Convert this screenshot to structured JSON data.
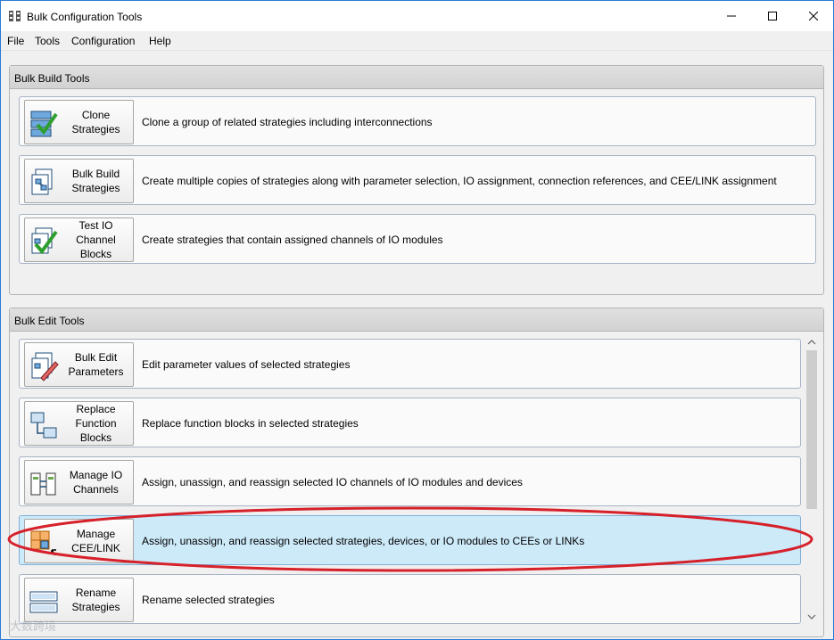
{
  "window": {
    "title": "Bulk Configuration Tools",
    "controls": [
      "minimize",
      "maximize",
      "close"
    ]
  },
  "menu": [
    "File",
    "Tools",
    "Configuration",
    "Help"
  ],
  "build_group": {
    "title": "Bulk Build Tools",
    "items": [
      {
        "label": "Clone\nStrategies",
        "desc": "Clone a group of related strategies including interconnections",
        "icon": "clone-strategies-icon"
      },
      {
        "label": "Bulk Build\nStrategies",
        "desc": "Create multiple copies of strategies along with parameter selection, IO assignment, connection references, and CEE/LINK assignment",
        "icon": "bulk-build-icon"
      },
      {
        "label": "Test IO\nChannel\nBlocks",
        "desc": "Create strategies that contain assigned channels of IO modules",
        "icon": "test-io-icon"
      }
    ]
  },
  "edit_group": {
    "title": "Bulk Edit Tools",
    "items": [
      {
        "label": "Bulk Edit\nParameters",
        "desc": "Edit parameter values of selected strategies",
        "icon": "bulk-edit-icon"
      },
      {
        "label": "Replace\nFunction\nBlocks",
        "desc": "Replace function blocks in selected strategies",
        "icon": "replace-blocks-icon"
      },
      {
        "label": "Manage IO\nChannels",
        "desc": "Assign, unassign, and reassign selected  IO channels of IO modules and devices",
        "icon": "manage-io-icon"
      },
      {
        "label": "Manage\nCEE/LINK",
        "desc": "Assign, unassign, and reassign selected strategies, devices, or IO modules to CEEs or LINKs",
        "icon": "manage-cee-icon",
        "selected": true
      },
      {
        "label": "Rename\nStrategies",
        "desc": "Rename selected strategies",
        "icon": "rename-icon"
      }
    ]
  },
  "colors": {
    "selected_row": "#cdeaf9",
    "annotation": "#d6202a",
    "title_border": "#2a7bd6"
  },
  "watermark": "大数跨境"
}
